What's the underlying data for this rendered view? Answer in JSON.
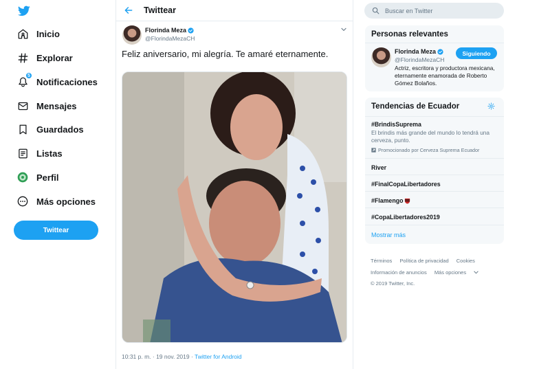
{
  "nav": {
    "items": [
      {
        "label": "Inicio",
        "icon": "home-icon"
      },
      {
        "label": "Explorar",
        "icon": "hashtag-icon"
      },
      {
        "label": "Notificaciones",
        "icon": "bell-icon",
        "badge": "5"
      },
      {
        "label": "Mensajes",
        "icon": "envelope-icon"
      },
      {
        "label": "Guardados",
        "icon": "bookmark-icon"
      },
      {
        "label": "Listas",
        "icon": "list-icon"
      },
      {
        "label": "Perfil",
        "icon": "avatar-icon"
      },
      {
        "label": "Más opciones",
        "icon": "more-icon"
      }
    ],
    "tweet_button": "Twittear"
  },
  "main": {
    "title": "Twittear",
    "tweet": {
      "author_name": "Florinda Meza",
      "author_handle": "@FlorindaMezaCH",
      "text": "Feliz aniversario, mi alegría. Te amaré eternamente.",
      "time": "10:31 p. m. · 19 nov. 2019",
      "separator": " · ",
      "source": "Twitter for Android"
    }
  },
  "right": {
    "search_placeholder": "Buscar en Twitter",
    "relevant": {
      "title": "Personas relevantes",
      "name": "Florinda Meza",
      "handle": "@FlorindaMezaCH",
      "follow_label": "Siguiendo",
      "bio": "Actriz, escritora y productora mexicana, eternamente enamorada de Roberto Gómez Bolaños."
    },
    "trends": {
      "title": "Tendencias de Ecuador",
      "promoted": {
        "name": "#BrindisSuprema",
        "desc": "El brindis más grande del mundo lo tendrá una cerveza, punto.",
        "promo": "Promocionado por Cerveza Suprema Ecuador"
      },
      "items": [
        "River",
        "#FinalCopaLibertadores",
        "#Flamengo",
        "#CopaLibertadores2019"
      ],
      "show_more": "Mostrar más"
    },
    "footer": {
      "terms": "Términos",
      "privacy": "Política de privacidad",
      "cookies": "Cookies",
      "ads": "Información de anuncios",
      "more": "Más opciones",
      "copyright": "© 2019 Twitter, Inc."
    }
  },
  "colors": {
    "accent": "#1da1f2",
    "text": "#14171a",
    "muted": "#657786",
    "panel": "#f5f8fa",
    "border": "#e6ecf0"
  }
}
